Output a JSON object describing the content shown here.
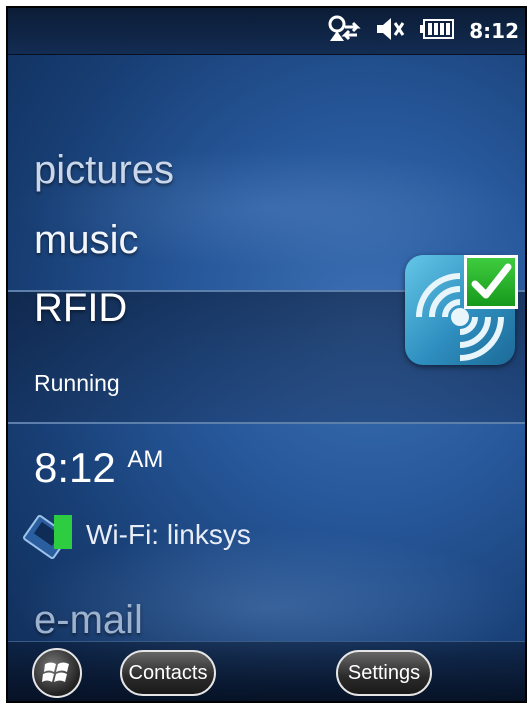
{
  "status": {
    "time": "8:12",
    "icons": [
      "sync-icon",
      "speaker-muted-icon",
      "battery-icon"
    ]
  },
  "menu": {
    "pictures": "pictures",
    "music": "music",
    "rfid": "RFID",
    "email": "e-mail"
  },
  "rfid": {
    "state": "Running"
  },
  "clock": {
    "time": "8:12",
    "ampm": "AM"
  },
  "wifi": {
    "label": "Wi-Fi: linksys"
  },
  "taskbar": {
    "start_icon": "windows-logo-icon",
    "contacts": "Contacts",
    "settings": "Settings"
  },
  "colors": {
    "background": "#27589b",
    "check": "#17991c",
    "tile": "#2f8fc0"
  }
}
